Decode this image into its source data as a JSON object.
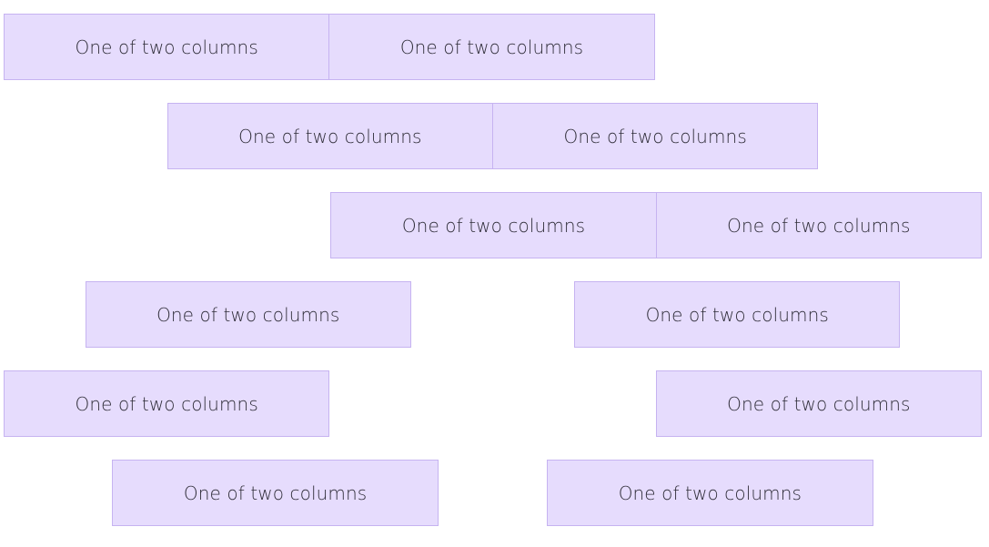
{
  "rows": [
    {
      "columns": [
        {
          "label": "One of two columns"
        },
        {
          "label": "One of two columns"
        }
      ]
    },
    {
      "columns": [
        {
          "label": "One of two columns"
        },
        {
          "label": "One of two columns"
        }
      ]
    },
    {
      "columns": [
        {
          "label": "One of two columns"
        },
        {
          "label": "One of two columns"
        }
      ]
    },
    {
      "columns": [
        {
          "label": "One of two columns"
        },
        {
          "label": "One of two columns"
        }
      ]
    },
    {
      "columns": [
        {
          "label": "One of two columns"
        },
        {
          "label": "One of two columns"
        }
      ]
    },
    {
      "columns": [
        {
          "label": "One of two columns"
        },
        {
          "label": "One of two columns"
        }
      ]
    }
  ],
  "colors": {
    "column_background": "#e6dcfd",
    "column_border": "#c6b3f1",
    "text": "#2f2d38"
  }
}
